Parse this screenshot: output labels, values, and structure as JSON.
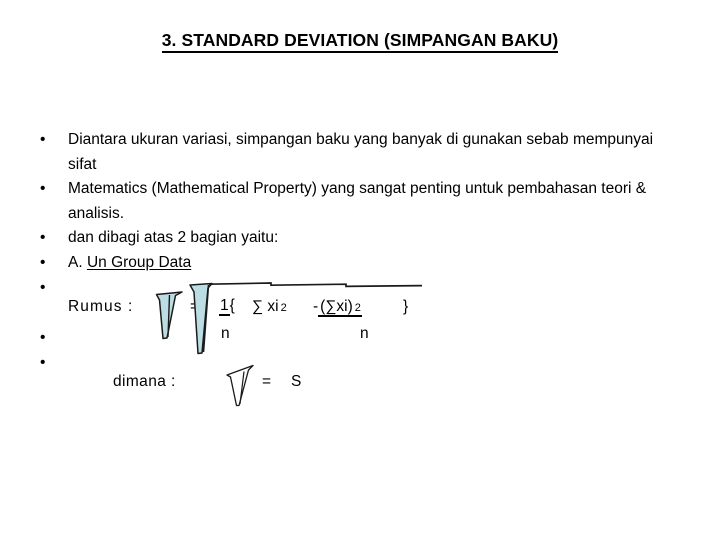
{
  "slide": {
    "title": "3. STANDARD DEVIATION (SIMPANGAN BAKU)",
    "background_color": "#ffffff",
    "text_color": "#000000",
    "radical_fill_color": "#bcdde3",
    "radical_stroke_color": "#1a1a1a"
  },
  "bullets": [
    {
      "marker": "•",
      "text": "Diantara ukuran variasi, simpangan baku yang banyak di gunakan sebab mempunyai sifat"
    },
    {
      "marker": "•",
      "text": "Matematics (Mathematical Property) yang sangat penting untuk pembahasan teori & analisis."
    },
    {
      "marker": "•",
      "text": "dan dibagi atas 2 bagian yaitu:"
    },
    {
      "marker": "•",
      "prefix": "A. ",
      "underlined_text": "Un Group Data"
    },
    {
      "marker": "•",
      "text": ""
    },
    {
      "marker": "•",
      "text": ""
    },
    {
      "marker": "•",
      "text": ""
    }
  ],
  "formula": {
    "label": "Rumus :",
    "equals": "=",
    "numerator": "1",
    "brace_open": "{",
    "denominator_left": "n",
    "sum_symbol": "∑",
    "sum_variable": "xi",
    "sum_exponent": "2",
    "minus": "-",
    "squared_sum": "(∑xi)",
    "squared_sum_exponent": "2",
    "denominator_right": "n",
    "brace_close": "}",
    "radical_symbol_name": "square-root"
  },
  "dimana": {
    "label": "dimana :",
    "equals": "=",
    "result": "S",
    "radical_symbol_name": "square-root"
  }
}
